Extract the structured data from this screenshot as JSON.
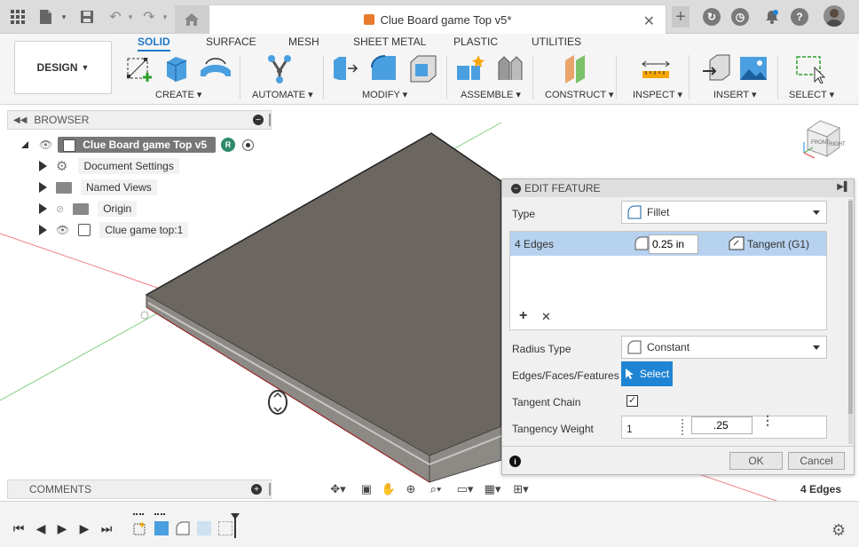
{
  "document": {
    "title": "Clue Board game Top v5*"
  },
  "topbar": {
    "icons": [
      "grid-icon",
      "file-icon",
      "save-icon",
      "undo-icon",
      "redo-icon",
      "home-icon",
      "add-tab-icon",
      "extensions-icon",
      "job-status-icon",
      "notifications-icon",
      "help-icon",
      "avatar"
    ]
  },
  "ribbon": {
    "workspace": "DESIGN",
    "tabs": [
      "SOLID",
      "SURFACE",
      "MESH",
      "SHEET METAL",
      "PLASTIC",
      "UTILITIES"
    ],
    "active_tab": "SOLID",
    "groups": [
      "CREATE",
      "AUTOMATE",
      "MODIFY",
      "ASSEMBLE",
      "CONSTRUCT",
      "INSPECT",
      "INSERT",
      "SELECT"
    ]
  },
  "browser": {
    "title": "BROWSER",
    "root": "Clue Board game Top v5",
    "items": [
      "Document Settings",
      "Named Views",
      "Origin",
      "Clue game top:1"
    ]
  },
  "edit_feature": {
    "title": "EDIT FEATURE",
    "type_label": "Type",
    "type_value": "Fillet",
    "edges_label": "4 Edges",
    "radius_value": "0.25 in",
    "continuity": "Tangent (G1)",
    "radius_type_label": "Radius Type",
    "radius_type_value": "Constant",
    "selection_label": "Edges/Faces/Features",
    "select_button": "Select",
    "tangent_chain_label": "Tangent Chain",
    "tangent_chain_checked": true,
    "tangency_weight_label": "Tangency Weight",
    "tangency_weight_value": "1",
    "tangency_weight_input": ".25",
    "ok": "OK",
    "cancel": "Cancel"
  },
  "comments": {
    "title": "COMMENTS"
  },
  "status": {
    "selection": "4 Edges"
  },
  "colors": {
    "accent": "#1f78c9",
    "select_button": "#1f84d3",
    "row_highlight": "#b6d2ef",
    "model_top": "#6b6660",
    "model_side": "#8d8a86"
  }
}
